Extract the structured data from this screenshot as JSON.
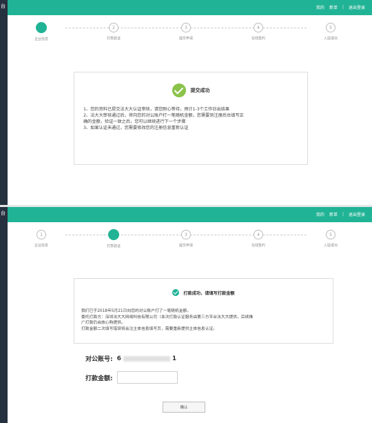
{
  "top": {
    "sidebar_glyph": "台",
    "header": {
      "links": [
        "我的",
        "新单",
        "退出登录"
      ],
      "separator": "|"
    },
    "steps": [
      {
        "index": "1",
        "label": "企业信息",
        "active": true
      },
      {
        "index": "2",
        "label": "打款验证",
        "active": false
      },
      {
        "index": "3",
        "label": "提交申请",
        "active": false
      },
      {
        "index": "4",
        "label": "在线签约",
        "active": false
      },
      {
        "index": "5",
        "label": "入驻成功",
        "active": false
      }
    ],
    "card": {
      "title": "提交成功",
      "lines": [
        "1、您的资料已提交法大大认证审核，请您耐心等待，预计1-3个工作日出结果",
        "2、法大大审核通过后，将向您的对公账户打一笔随机金额，您需要到注册后台填写正",
        "确的金额，验证一致之后，您可以继续进行下一个步骤",
        "3、如果认证未通过，您需要修改您的注册信息重新认证"
      ]
    }
  },
  "bottom": {
    "sidebar_glyph": "台",
    "header": {
      "links": [
        "我的",
        "新单",
        "退出登录"
      ],
      "separator": "|"
    },
    "steps": [
      {
        "index": "1",
        "label": "企业信息",
        "active": false
      },
      {
        "index": "2",
        "label": "打款验证",
        "active": true
      },
      {
        "index": "3",
        "label": "提交申请",
        "active": false
      },
      {
        "index": "4",
        "label": "在线签约",
        "active": false
      },
      {
        "index": "5",
        "label": "入驻成功",
        "active": false
      }
    ],
    "card": {
      "title": "打款成功，请填写打款金额",
      "lines": [
        "我们已于2018年5月21日向您的对公账户打了一笔随机金额。",
        "委托打款方：深圳法大大网络科技有限公司（本次打款认证服务由第三方平台法大大提供，后续推",
        "广打款仍由放心购提供。",
        "打款金额二次填写错误将会注主体信息填写页，需要重新提供主体信息认证。"
      ]
    },
    "form": {
      "account_label": "对公账号:",
      "account_prefix": "6",
      "account_suffix": "1",
      "amount_label": "打款金额:",
      "amount_value": ""
    },
    "confirm_label": "确认"
  },
  "colors": {
    "brand": "#21b395",
    "sidebar": "#26313f",
    "success_icon": "#8bc34a"
  }
}
